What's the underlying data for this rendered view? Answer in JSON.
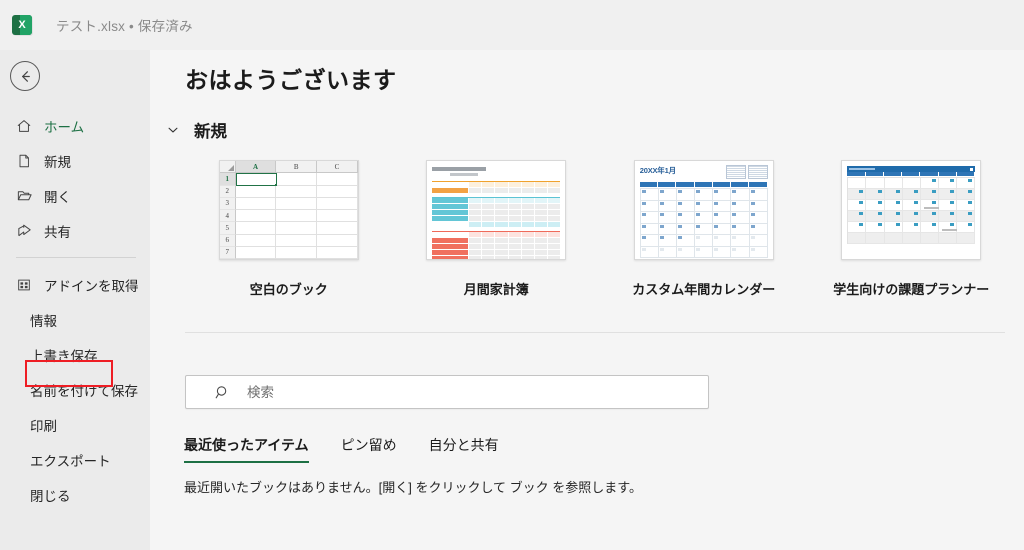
{
  "titlebar": {
    "app_icon": "excel-icon",
    "app_icon_letter": "X",
    "document_title": "テスト.xlsx • 保存済み"
  },
  "sidebar": {
    "back_label": "←",
    "items": [
      {
        "label": "ホーム",
        "icon": "home-icon",
        "active": true
      },
      {
        "label": "新規",
        "icon": "new-document-icon",
        "active": false
      },
      {
        "label": "開く",
        "icon": "folder-open-icon",
        "active": false
      },
      {
        "label": "共有",
        "icon": "share-icon",
        "active": false
      },
      {
        "label": "アドインを取得",
        "icon": "addins-grid-icon",
        "active": false
      },
      {
        "label": "情報",
        "icon": "",
        "active": false
      },
      {
        "label": "上書き保存",
        "icon": "",
        "active": false
      },
      {
        "label": "名前を付けて保存",
        "icon": "",
        "active": false
      },
      {
        "label": "印刷",
        "icon": "",
        "active": false
      },
      {
        "label": "エクスポート",
        "icon": "",
        "active": false
      },
      {
        "label": "閉じる",
        "icon": "",
        "active": false
      }
    ],
    "highlight": {
      "target_label": "上書き保存",
      "color": "#ee1d24"
    }
  },
  "main": {
    "greeting": "おはようございます",
    "new_section": {
      "title": "新規",
      "chevron": "chevron-down-icon",
      "templates": [
        {
          "label": "空白のブック",
          "thumb": "blank-workbook"
        },
        {
          "label": "月間家計簿",
          "thumb": "monthly-budget"
        },
        {
          "label": "カスタム年間カレンダー",
          "thumb": "custom-calendar"
        },
        {
          "label": "学生向けの課題プランナー",
          "thumb": "student-planner"
        }
      ]
    },
    "blank_workbook_thumb": {
      "columns": [
        "A",
        "B",
        "C"
      ],
      "rows": [
        "1",
        "2",
        "3",
        "4",
        "5",
        "6",
        "7"
      ],
      "selected_cell": "A1",
      "selection_color": "#217346"
    },
    "calendar_thumb": {
      "title": "20XX年1月",
      "header_color": "#2e75b6"
    },
    "search": {
      "placeholder": "検索",
      "value": "",
      "icon": "search-icon"
    },
    "tabs": [
      {
        "label": "最近使ったアイテム",
        "active": true
      },
      {
        "label": "ピン留め",
        "active": false
      },
      {
        "label": "自分と共有",
        "active": false
      }
    ],
    "empty_message": "最近開いたブックはありません。[開く] をクリックして ブック を参照します。"
  },
  "colors": {
    "accent_green": "#1d7044",
    "sidebar_bg": "#ebebeb",
    "content_bg": "#f5f5f5",
    "highlight_red": "#ee1d24"
  }
}
